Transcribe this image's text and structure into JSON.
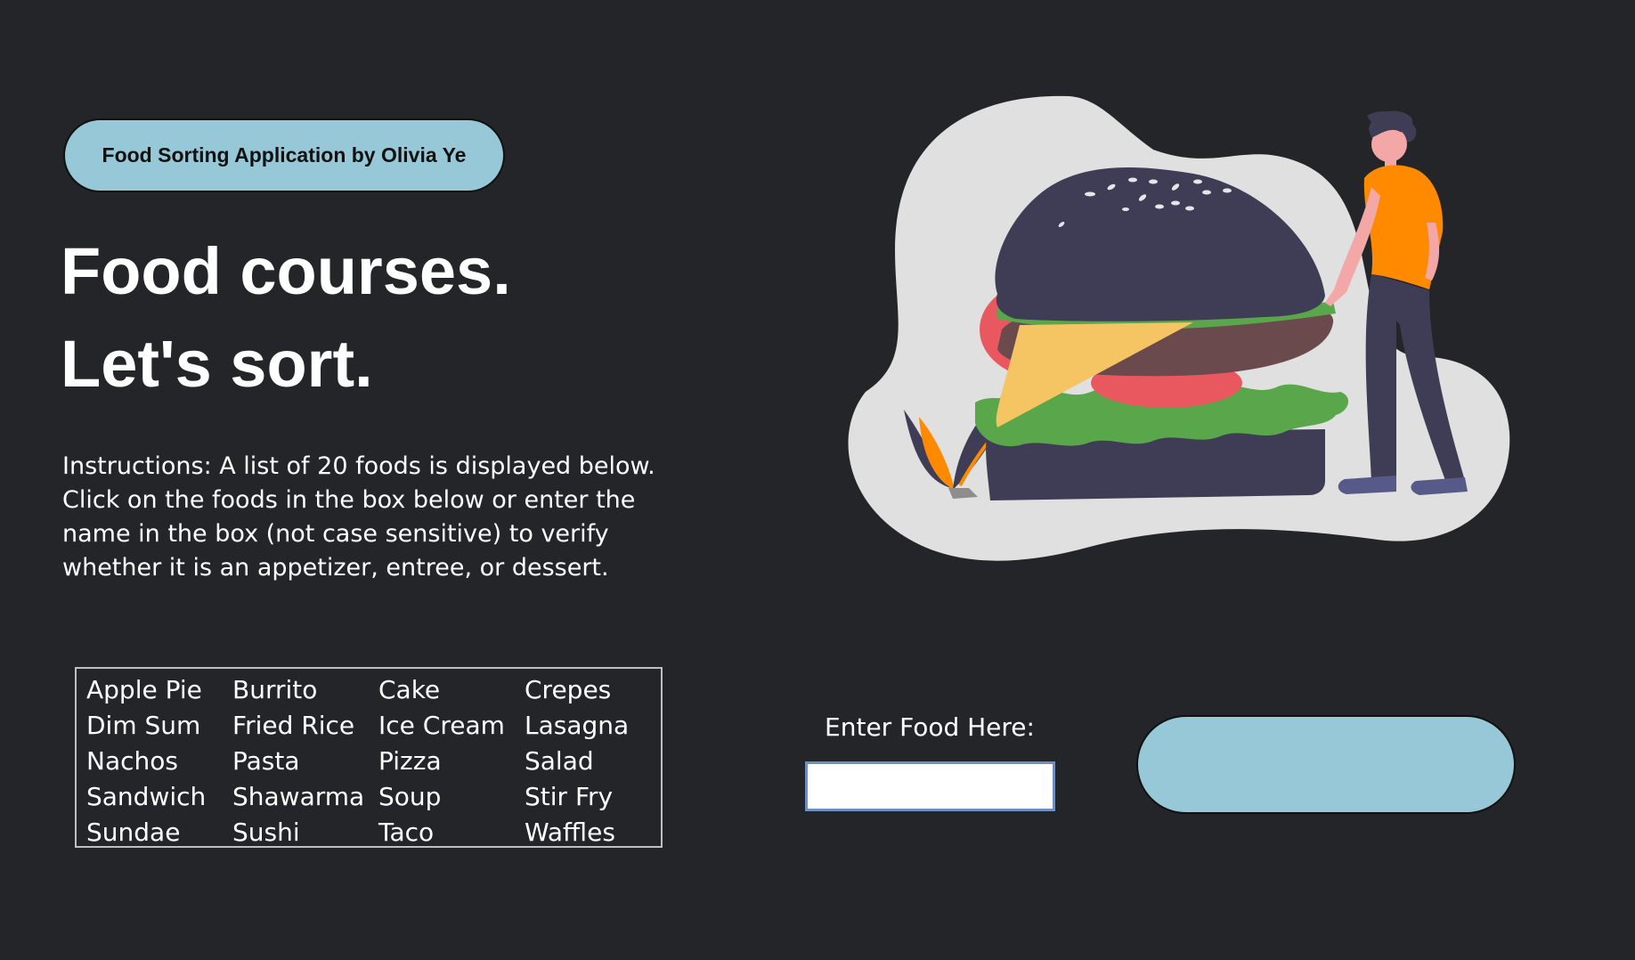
{
  "header": {
    "title_pill": "Food Sorting Application by Olivia Ye"
  },
  "hero": {
    "line1": "Food courses.",
    "line2": "Let's sort."
  },
  "instructions": "Instructions: A list of 20 foods is displayed below. Click on the foods in the box below or enter the name in the box (not case sensitive) to verify whether it is an appetizer, entree, or dessert.",
  "foods": [
    "Apple Pie",
    "Burrito",
    "Cake",
    "Crepes",
    "Dim Sum",
    "Fried Rice",
    "Ice Cream",
    "Lasagna",
    "Nachos",
    "Pasta",
    "Pizza",
    "Salad",
    "Sandwich",
    "Shawarma",
    "Soup",
    "Stir Fry",
    "Sundae",
    "Sushi",
    "Taco",
    "Waffles"
  ],
  "entry": {
    "label": "Enter Food Here:",
    "value": "",
    "placeholder": ""
  },
  "result": {
    "text": ""
  },
  "colors": {
    "background": "#242528",
    "accent": "#96c8d8",
    "shirt": "#ff8a00",
    "bun": "#3f3d56",
    "lettuce": "#5aa64a",
    "tomato": "#e9575f",
    "cheese": "#f5c563",
    "blob": "#e0e0e0"
  },
  "icons": {
    "illustration": "burger-with-person-illustration"
  }
}
